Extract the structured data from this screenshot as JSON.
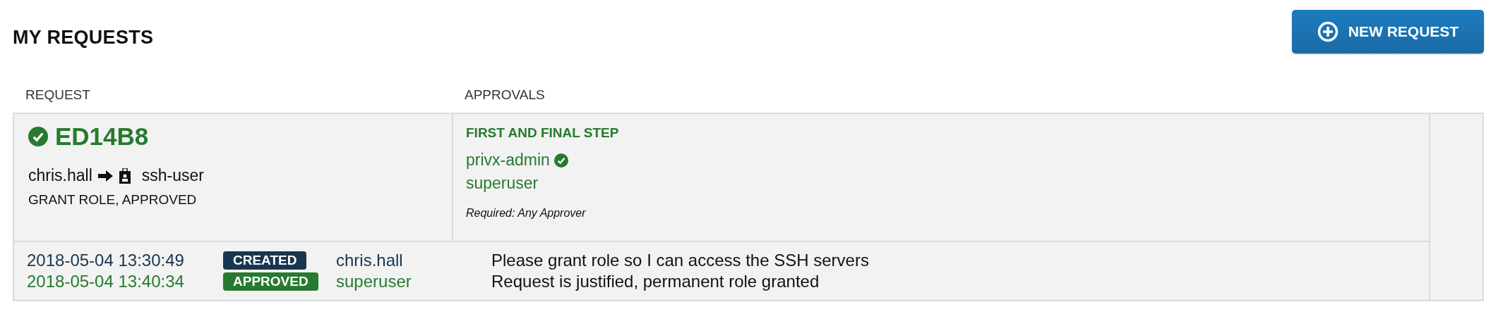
{
  "page": {
    "title": "MY REQUESTS"
  },
  "new_request_button": {
    "label": "NEW REQUEST"
  },
  "table": {
    "columns": [
      "REQUEST",
      "APPROVALS"
    ],
    "request": {
      "id": "ED14B8",
      "approved": true,
      "user": "chris.hall",
      "role": "ssh-user",
      "summary": "GRANT ROLE, APPROVED"
    },
    "approval_step": {
      "title": "FIRST AND FINAL STEP",
      "approvers": [
        {
          "name": "privx-admin",
          "approved": true
        },
        {
          "name": "superuser",
          "approved": false
        }
      ],
      "requirement": "Required: Any Approver"
    },
    "events": [
      {
        "kind": "created",
        "time": "2018-05-04 13:30:49",
        "status": "CREATED",
        "user": "chris.hall",
        "comment": "Please grant role so I can access the SSH servers"
      },
      {
        "kind": "approved",
        "time": "2018-05-04 13:40:34",
        "status": "APPROVED",
        "user": "superuser",
        "comment": "Request is justified, permanent role granted"
      }
    ]
  }
}
